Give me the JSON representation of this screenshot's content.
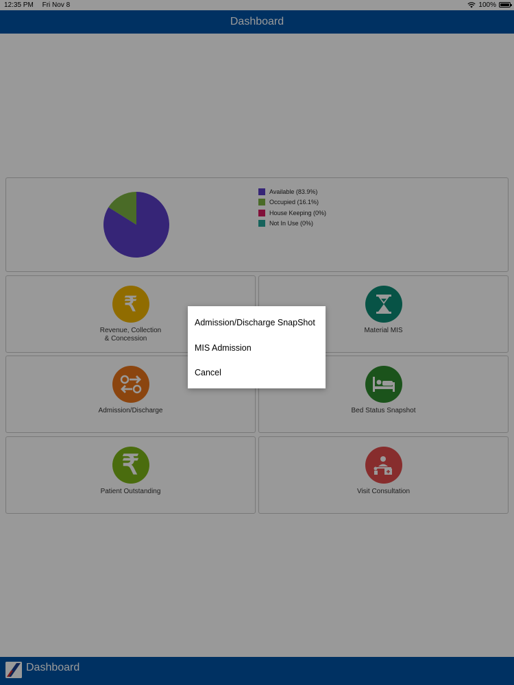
{
  "status_bar": {
    "time": "12:35 PM",
    "date": "Fri Nov 8",
    "battery": "100%",
    "wifi_icon": "wifi-icon",
    "battery_icon": "battery-icon"
  },
  "header": {
    "title": "Dashboard"
  },
  "bed_chart": {
    "chart_data": {
      "type": "pie",
      "categories": [
        "Available (83.9%)",
        "Occupied (16.1%)",
        "House Keeping (0%)",
        "Not In Use (0%)"
      ],
      "values": [
        83.9,
        16.1,
        0,
        0
      ],
      "colors": [
        "#5b3fc7",
        "#7cb342",
        "#d81b60",
        "#26a69a"
      ],
      "title": ""
    }
  },
  "tiles": [
    {
      "label_line1": "Revenue, Collection",
      "label_line2": "& Concession",
      "icon": "rupee-icon",
      "color": "#f0b400"
    },
    {
      "label_line1": "Material MIS",
      "label_line2": "",
      "icon": "hourglass-icon",
      "color": "#0c8b75"
    },
    {
      "label_line1": "Admission/Discharge",
      "label_line2": "",
      "icon": "admission-discharge-icon",
      "color": "#e8731a"
    },
    {
      "label_line1": "Bed Status Snapshot",
      "label_line2": "",
      "icon": "bed-icon",
      "color": "#2e8b2e"
    },
    {
      "label_line1": "Patient Outstanding",
      "label_line2": "",
      "icon": "rupee-icon",
      "color": "#7cb518"
    },
    {
      "label_line1": "Visit Consultation",
      "label_line2": "",
      "icon": "doctor-icon",
      "color": "#e24b4b"
    }
  ],
  "dialog": {
    "items": [
      "Admission/Discharge SnapShot",
      "MIS Admission",
      "Cancel"
    ]
  },
  "tab_bar": {
    "label": "Dashboard",
    "logo_icon": "app-logo-icon"
  }
}
